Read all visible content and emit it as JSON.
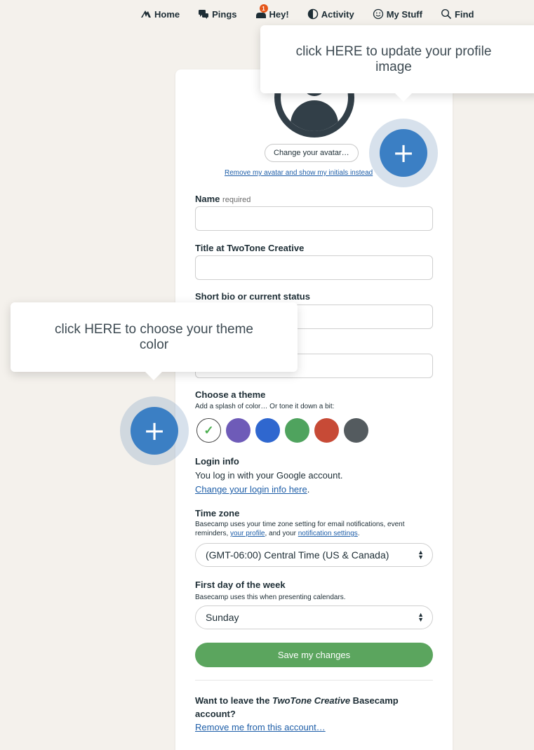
{
  "nav": {
    "items": [
      {
        "label": "Home",
        "icon": "basecamp-mountain-icon"
      },
      {
        "label": "Pings",
        "icon": "chat-bubbles-icon"
      },
      {
        "label": "Hey!",
        "icon": "hey-wave-icon",
        "badge": "1"
      },
      {
        "label": "Activity",
        "icon": "activity-moon-icon"
      },
      {
        "label": "My Stuff",
        "icon": "smiley-face-icon"
      },
      {
        "label": "Find",
        "icon": "search-icon"
      }
    ]
  },
  "profile": {
    "change_avatar_label": "Change your avatar…",
    "remove_avatar_label": "Remove my avatar and show my initials instead"
  },
  "fields": {
    "name_label": "Name",
    "name_required": "required",
    "name_value": "",
    "title_label": "Title at TwoTone Creative",
    "title_value": "",
    "bio_label": "Short bio or current status",
    "bio_value": "",
    "fourth_value": ""
  },
  "theme": {
    "heading": "Choose a theme",
    "subtext": "Add a splash of color… Or tone it down a bit:",
    "check_glyph": "✓",
    "colors": [
      "#ffffff",
      "#6e5bb8",
      "#2f67cf",
      "#4fa35e",
      "#c74a36",
      "#545b5f"
    ]
  },
  "login": {
    "heading": "Login info",
    "line1": "You log in with your Google account.",
    "link": "Change your login info here",
    "period": "."
  },
  "timezone": {
    "heading": "Time zone",
    "desc_part1": "Basecamp uses your time zone setting for email notifications, event reminders, ",
    "desc_link1": "your profile",
    "desc_part2": ", and your ",
    "desc_link2": "notification settings",
    "desc_part3": ".",
    "selected": "(GMT-06:00) Central Time (US & Canada)"
  },
  "first_day": {
    "heading": "First day of the week",
    "desc": "Basecamp uses this when presenting calendars.",
    "selected": "Sunday"
  },
  "save_label": "Save my changes",
  "leave": {
    "prefix": "Want to leave the ",
    "account": "TwoTone Creative",
    "suffix": " Basecamp account?",
    "link": "Remove me from this account…"
  },
  "tooltips": {
    "avatar": "click HERE to update your profile image",
    "theme": "click HERE to choose your theme color"
  },
  "hotspot_glyph": "+"
}
